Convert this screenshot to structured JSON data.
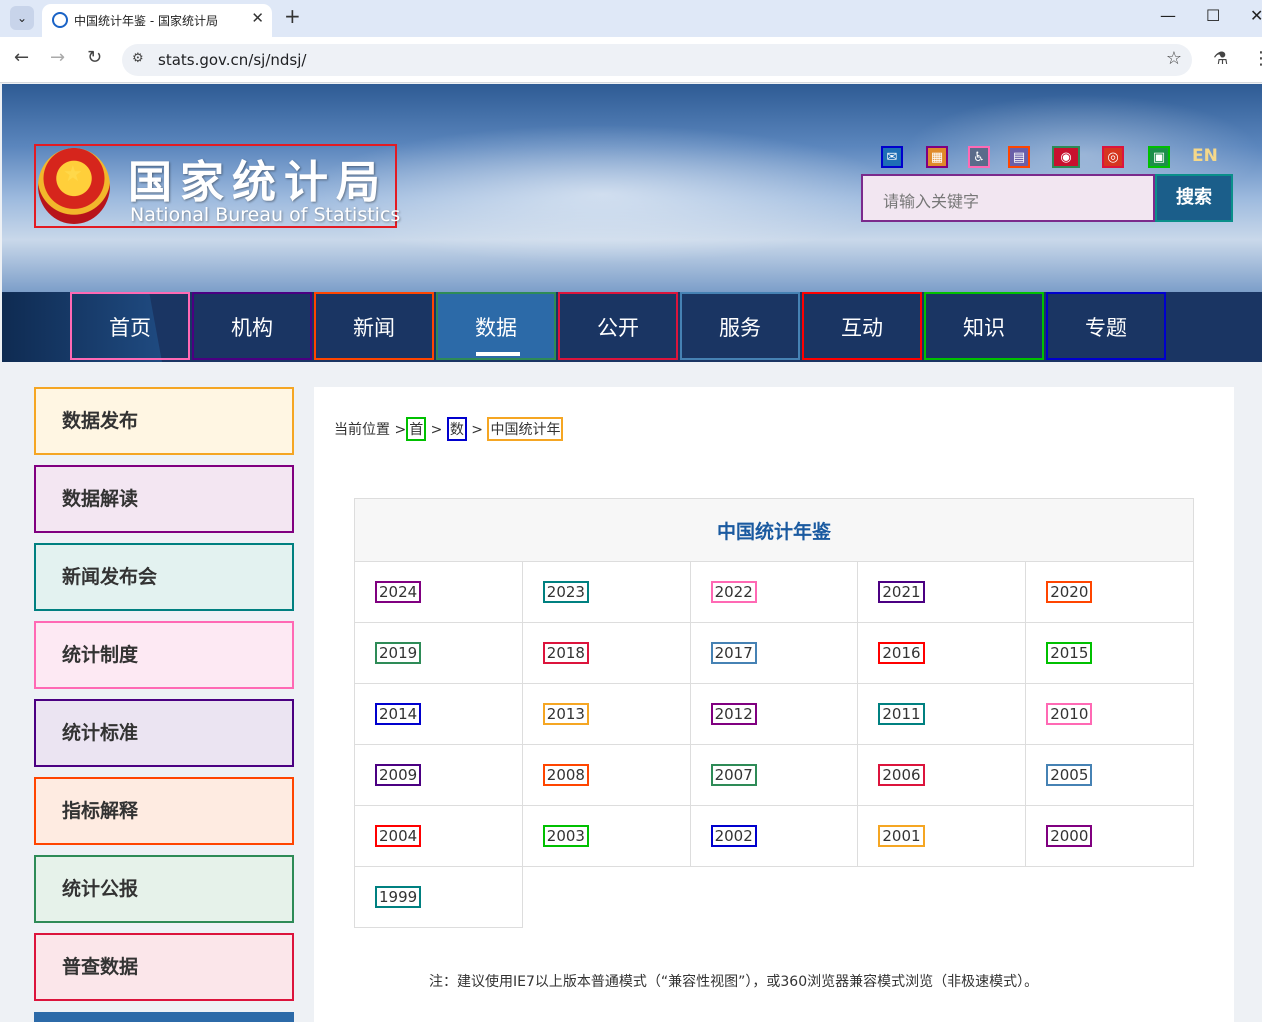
{
  "browser": {
    "tab_title": "中国统计年鉴 - 国家统计局",
    "tab_close": "✕",
    "new_tab": "+",
    "url": "stats.gov.cn/sj/ndsj/",
    "minimize": "—",
    "maximize": "☐",
    "close": "✕"
  },
  "header": {
    "logo_cn": "国家统计局",
    "logo_en": "National Bureau of Statistics",
    "en_link": "EN",
    "search_placeholder": "请输入关键字",
    "search_button": "搜索"
  },
  "nav": {
    "items": [
      {
        "label": "首页",
        "color": "#ff69b4"
      },
      {
        "label": "机构",
        "color": "#4b0082"
      },
      {
        "label": "新闻",
        "color": "#ff4500"
      },
      {
        "label": "数据",
        "color": "#2e8b57",
        "active": true
      },
      {
        "label": "公开",
        "color": "#dc143c"
      },
      {
        "label": "服务",
        "color": "#4682b4"
      },
      {
        "label": "互动",
        "color": "#ff0000"
      },
      {
        "label": "知识",
        "color": "#00c000"
      },
      {
        "label": "专题",
        "color": "#0000cd"
      }
    ]
  },
  "sidebar": {
    "items": [
      {
        "label": "数据发布",
        "border": "#f5a623",
        "bg": "#fff6e3"
      },
      {
        "label": "数据解读",
        "border": "#800080",
        "bg": "#f3e6f2"
      },
      {
        "label": "新闻发布会",
        "border": "#008080",
        "bg": "#e3f2f0"
      },
      {
        "label": "统计制度",
        "border": "#ff69b4",
        "bg": "#fde9f3"
      },
      {
        "label": "统计标准",
        "border": "#4b0082",
        "bg": "#ebe4f2"
      },
      {
        "label": "指标解释",
        "border": "#ff4500",
        "bg": "#feebe1"
      },
      {
        "label": "统计公报",
        "border": "#2e8b57",
        "bg": "#e6f2ea"
      },
      {
        "label": "普查数据",
        "border": "#dc143c",
        "bg": "#fbe6ea"
      }
    ]
  },
  "breadcrumb": {
    "prefix": "当前位置 >",
    "home": "首",
    "sep1": ">",
    "data": "数",
    "sep2": ">",
    "current": "中国统计年"
  },
  "yearbook": {
    "title": "中国统计年鉴",
    "years": [
      {
        "label": "2024",
        "color": "#800080"
      },
      {
        "label": "2023",
        "color": "#008080"
      },
      {
        "label": "2022",
        "color": "#ff69b4"
      },
      {
        "label": "2021",
        "color": "#4b0082"
      },
      {
        "label": "2020",
        "color": "#ff4500"
      },
      {
        "label": "2019",
        "color": "#2e8b57"
      },
      {
        "label": "2018",
        "color": "#dc143c"
      },
      {
        "label": "2017",
        "color": "#4682b4"
      },
      {
        "label": "2016",
        "color": "#ff0000"
      },
      {
        "label": "2015",
        "color": "#00c000"
      },
      {
        "label": "2014",
        "color": "#0000cd"
      },
      {
        "label": "2013",
        "color": "#f5a623"
      },
      {
        "label": "2012",
        "color": "#800080"
      },
      {
        "label": "2011",
        "color": "#008080"
      },
      {
        "label": "2010",
        "color": "#ff69b4"
      },
      {
        "label": "2009",
        "color": "#4b0082"
      },
      {
        "label": "2008",
        "color": "#ff4500"
      },
      {
        "label": "2007",
        "color": "#2e8b57"
      },
      {
        "label": "2006",
        "color": "#dc143c"
      },
      {
        "label": "2005",
        "color": "#4682b4"
      },
      {
        "label": "2004",
        "color": "#ff0000"
      },
      {
        "label": "2003",
        "color": "#00c000"
      },
      {
        "label": "2002",
        "color": "#0000cd"
      },
      {
        "label": "2001",
        "color": "#f5a623"
      },
      {
        "label": "2000",
        "color": "#800080"
      },
      {
        "label": "1999",
        "color": "#008080"
      }
    ]
  },
  "note": "注：建议使用IE7以上版本普通模式（“兼容性视图”），或360浏览器兼容模式浏览（非极速模式）。"
}
